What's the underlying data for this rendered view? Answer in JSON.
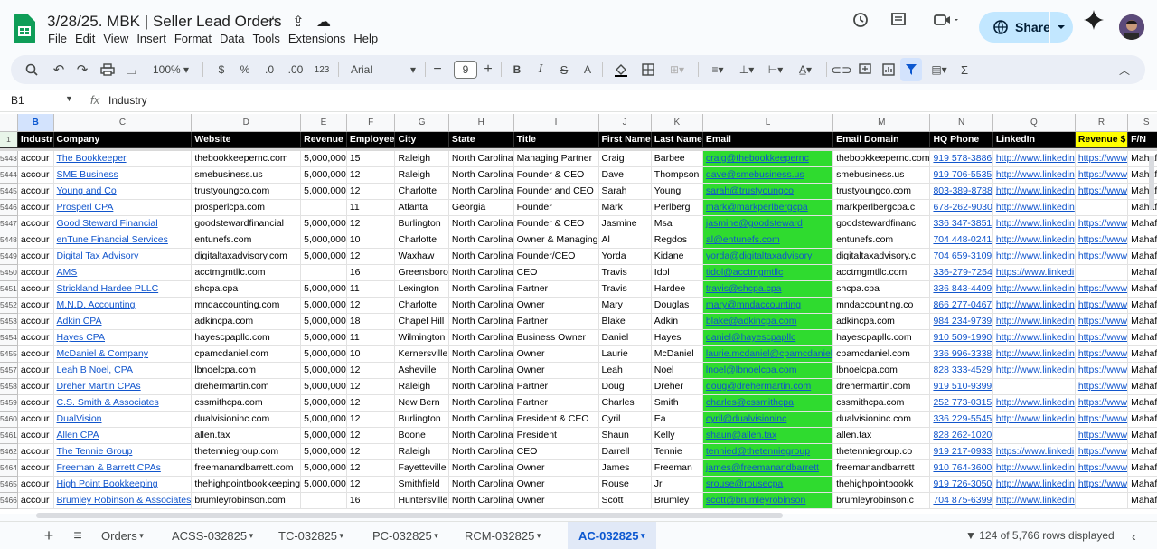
{
  "doc": {
    "title": "3/28/25. MBK | Seller Lead Orders"
  },
  "menus": [
    "File",
    "Edit",
    "View",
    "Insert",
    "Format",
    "Data",
    "Tools",
    "Extensions",
    "Help"
  ],
  "share_label": "Share",
  "toolbar": {
    "zoom": "100%",
    "currency": "$",
    "percent": "%",
    "dec_dec": ".0",
    "inc_dec": ".00",
    "numfmt": "123",
    "font": "Arial",
    "font_size": "9",
    "bold": "B",
    "italic": "I",
    "text_color": "A",
    "sigma": "Σ"
  },
  "formula_bar": {
    "cell_ref": "B1",
    "fx": "fx",
    "value": "Industry"
  },
  "columns": [
    "B",
    "C",
    "D",
    "E",
    "F",
    "G",
    "H",
    "I",
    "J",
    "K",
    "L",
    "M",
    "N",
    "Q",
    "R",
    "S"
  ],
  "header_row": {
    "num": "1",
    "cells": [
      "Industr",
      "Company",
      "Website",
      "Revenue",
      "Employee",
      "City",
      "State",
      "Title",
      "First Name",
      "Last Name",
      "Email",
      "Email Domain",
      "HQ Phone",
      "LinkedIn",
      "Revenue $",
      "F/N"
    ]
  },
  "rows": [
    [
      "5443",
      "accour",
      "The Bookkeeper",
      "thebookkeepernc.com",
      "5,000,000",
      "15",
      "Raleigh",
      "North Carolina",
      "Managing Partner",
      "Craig",
      "Barbee",
      "craig@thebookkeepernc",
      "thebookkeepernc.com",
      "919 578-3886",
      "http://www.linkedin",
      "https://www",
      "Mahafuj"
    ],
    [
      "5444",
      "accour",
      "SME Business",
      "smebusiness.us",
      "5,000,000",
      "12",
      "Raleigh",
      "North Carolina",
      "Founder & CEO",
      "Dave",
      "Thompson",
      "dave@smebusiness.us",
      "smebusiness.us",
      "919 706-5535",
      "http://www.linkedin",
      "https://www",
      "Mahafuj"
    ],
    [
      "5445",
      "accour",
      "Young and Co",
      "trustyoungco.com",
      "5,000,000",
      "12",
      "Charlotte",
      "North Carolina",
      "Founder and CEO",
      "Sarah",
      "Young",
      "sarah@trustyoungco",
      "trustyoungco.com",
      "803-389-8788",
      "http://www.linkedin",
      "https://www",
      "Mahafuj"
    ],
    [
      "5446",
      "accour",
      "Prosperl CPA",
      "prosperlcpa.com",
      "",
      "11",
      "Atlanta",
      "Georgia",
      "Founder",
      "Mark",
      "Perlberg",
      "mark@markperlbergcpa",
      "markperlbergcpa.c",
      "678-262-9030",
      "http://www.linkedin",
      "",
      "Mahafuj"
    ],
    [
      "5447",
      "accour",
      "Good Steward Financial",
      "goodstewardfinancial",
      "5,000,000",
      "12",
      "Burlington",
      "North Carolina",
      "Founder & CEO",
      "Jasmine",
      "Msa",
      "jasmine@goodsteward",
      "goodstewardfinanc",
      "336 347-3851",
      "http://www.linkedin",
      "https://www",
      "Mahafuj"
    ],
    [
      "5448",
      "accour",
      "enTune Financial Services",
      "entunefs.com",
      "5,000,000",
      "10",
      "Charlotte",
      "North Carolina",
      "Owner & Managing",
      "Al",
      "Regdos",
      "al@entunefs.com",
      "entunefs.com",
      "704 448-0241",
      "http://www.linkedin",
      "https://www",
      "Mahafuj"
    ],
    [
      "5449",
      "accour",
      "Digital Tax Advisory",
      "digitaltaxadvisory.com",
      "5,000,000",
      "12",
      "Waxhaw",
      "North Carolina",
      "Founder/CEO",
      "Yorda",
      "Kidane",
      "yorda@digitaltaxadvisory",
      "digitaltaxadvisory.c",
      "704 659-3109",
      "http://www.linkedin",
      "https://www",
      "Mahafuj"
    ],
    [
      "5450",
      "accour",
      "AMS",
      "acctmgmtllc.com",
      "",
      "16",
      "Greensboro",
      "North Carolina",
      "CEO",
      "Travis",
      "Idol",
      "tidol@acctmgmtllc",
      "acctmgmtllc.com",
      "336-279-7254",
      "https://www.linkedi",
      "",
      "Mahafuj"
    ],
    [
      "5451",
      "accour",
      "Strickland Hardee PLLC",
      "shcpa.cpa",
      "5,000,000",
      "11",
      "Lexington",
      "North Carolina",
      "Partner",
      "Travis",
      "Hardee",
      "travis@shcpa.cpa",
      "shcpa.cpa",
      "336 843-4409",
      "http://www.linkedin",
      "https://www",
      "Mahafuj"
    ],
    [
      "5452",
      "accour",
      "M.N.D. Accounting",
      "mndaccounting.com",
      "5,000,000",
      "12",
      "Charlotte",
      "North Carolina",
      "Owner",
      "Mary",
      "Douglas",
      "mary@mndaccounting",
      "mndaccounting.co",
      "866 277-0467",
      "http://www.linkedin",
      "https://www",
      "Mahafuj"
    ],
    [
      "5453",
      "accour",
      "Adkin CPA",
      "adkincpa.com",
      "5,000,000",
      "18",
      "Chapel Hill",
      "North Carolina",
      "Partner",
      "Blake",
      "Adkin",
      "blake@adkincpa.com",
      "adkincpa.com",
      "984 234-9739",
      "http://www.linkedin",
      "https://www",
      "Mahafuj"
    ],
    [
      "5454",
      "accour",
      "Hayes CPA",
      "hayescpapllc.com",
      "5,000,000",
      "11",
      "Wilmington",
      "North Carolina",
      "Business Owner",
      "Daniel",
      "Hayes",
      "daniel@hayescpapllc",
      "hayescpapllc.com",
      "910 509-1990",
      "http://www.linkedin",
      "https://www",
      "Mahafuj"
    ],
    [
      "5455",
      "accour",
      "McDaniel & Company",
      "cpamcdaniel.com",
      "5,000,000",
      "10",
      "Kernersville",
      "North Carolina",
      "Owner",
      "Laurie",
      "McDaniel",
      "laurie.mcdaniel@cpamcdaniel",
      "cpamcdaniel.com",
      "336 996-3338",
      "http://www.linkedin",
      "https://www",
      "Mahafuj"
    ],
    [
      "5457",
      "accour",
      "Leah B Noel, CPA",
      "lbnoelcpa.com",
      "5,000,000",
      "12",
      "Asheville",
      "North Carolina",
      "Owner",
      "Leah",
      "Noel",
      "lnoel@lbnoelcpa.com",
      "lbnoelcpa.com",
      "828 333-4529",
      "http://www.linkedin",
      "https://www",
      "Mahafuj"
    ],
    [
      "5458",
      "accour",
      "Dreher Martin CPAs",
      "drehermartin.com",
      "5,000,000",
      "12",
      "Raleigh",
      "North Carolina",
      "Partner",
      "Doug",
      "Dreher",
      "doug@drehermartin.com",
      "drehermartin.com",
      "919 510-9399",
      "",
      "https://www",
      "Mahafuj"
    ],
    [
      "5459",
      "accour",
      "C.S. Smith & Associates",
      "cssmithcpa.com",
      "5,000,000",
      "12",
      "New Bern",
      "North Carolina",
      "Partner",
      "Charles",
      "Smith",
      "charles@cssmithcpa",
      "cssmithcpa.com",
      "252 773-0315",
      "http://www.linkedin",
      "https://www",
      "Mahafuj"
    ],
    [
      "5460",
      "accour",
      "DualVision",
      "dualvisioninc.com",
      "5,000,000",
      "12",
      "Burlington",
      "North Carolina",
      "President & CEO",
      "Cyril",
      "Ea",
      "cyril@dualvisioninc",
      "dualvisioninc.com",
      "336 229-5545",
      "http://www.linkedin",
      "https://www",
      "Mahafuj"
    ],
    [
      "5461",
      "accour",
      "Allen CPA",
      "allen.tax",
      "5,000,000",
      "12",
      "Boone",
      "North Carolina",
      "President",
      "Shaun",
      "Kelly",
      "shaun@allen.tax",
      "allen.tax",
      "828 262-1020",
      "",
      "https://www",
      "Mahafuj"
    ],
    [
      "5462",
      "accour",
      "The Tennie Group",
      "thetenniegroup.com",
      "5,000,000",
      "12",
      "Raleigh",
      "North Carolina",
      "CEO",
      "Darrell",
      "Tennie",
      "tennied@thetenniegroup",
      "thetenniegroup.co",
      "919 217-0933",
      "https://www.linkedi",
      "https://www",
      "Mahafuj"
    ],
    [
      "5464",
      "accour",
      "Freeman & Barrett CPAs",
      "freemanandbarrett.com",
      "5,000,000",
      "12",
      "Fayetteville",
      "North Carolina",
      "Owner",
      "James",
      "Freeman",
      "james@freemanandbarrett",
      "freemanandbarrett",
      "910 764-3600",
      "http://www.linkedin",
      "https://www",
      "Mahafuj"
    ],
    [
      "5465",
      "accour",
      "High Point Bookkeeping",
      "thehighpointbookkeeping",
      "5,000,000",
      "12",
      "Smithfield",
      "North Carolina",
      "Owner",
      "Rouse",
      "Jr",
      "srouse@rousecpa",
      "thehighpointbookk",
      "919 726-3050",
      "http://www.linkedin",
      "https://www",
      "Mahafuj"
    ],
    [
      "5466",
      "accour",
      "Brumley Robinson & Associates",
      "brumleyrobinson.com",
      "",
      "16",
      "Huntersville",
      "North Carolina",
      "Owner",
      "Scott",
      "Brumley",
      "scott@brumleyrobinson",
      "brumleyrobinson.c",
      "704 875-6399",
      "http://www.linkedin",
      "",
      "Mahafuj"
    ]
  ],
  "tabs": [
    "Orders",
    "ACSS-032825",
    "TC-032825",
    "PC-032825",
    "RCM-032825",
    "AC-032825"
  ],
  "status": "124 of 5,766 rows displayed"
}
